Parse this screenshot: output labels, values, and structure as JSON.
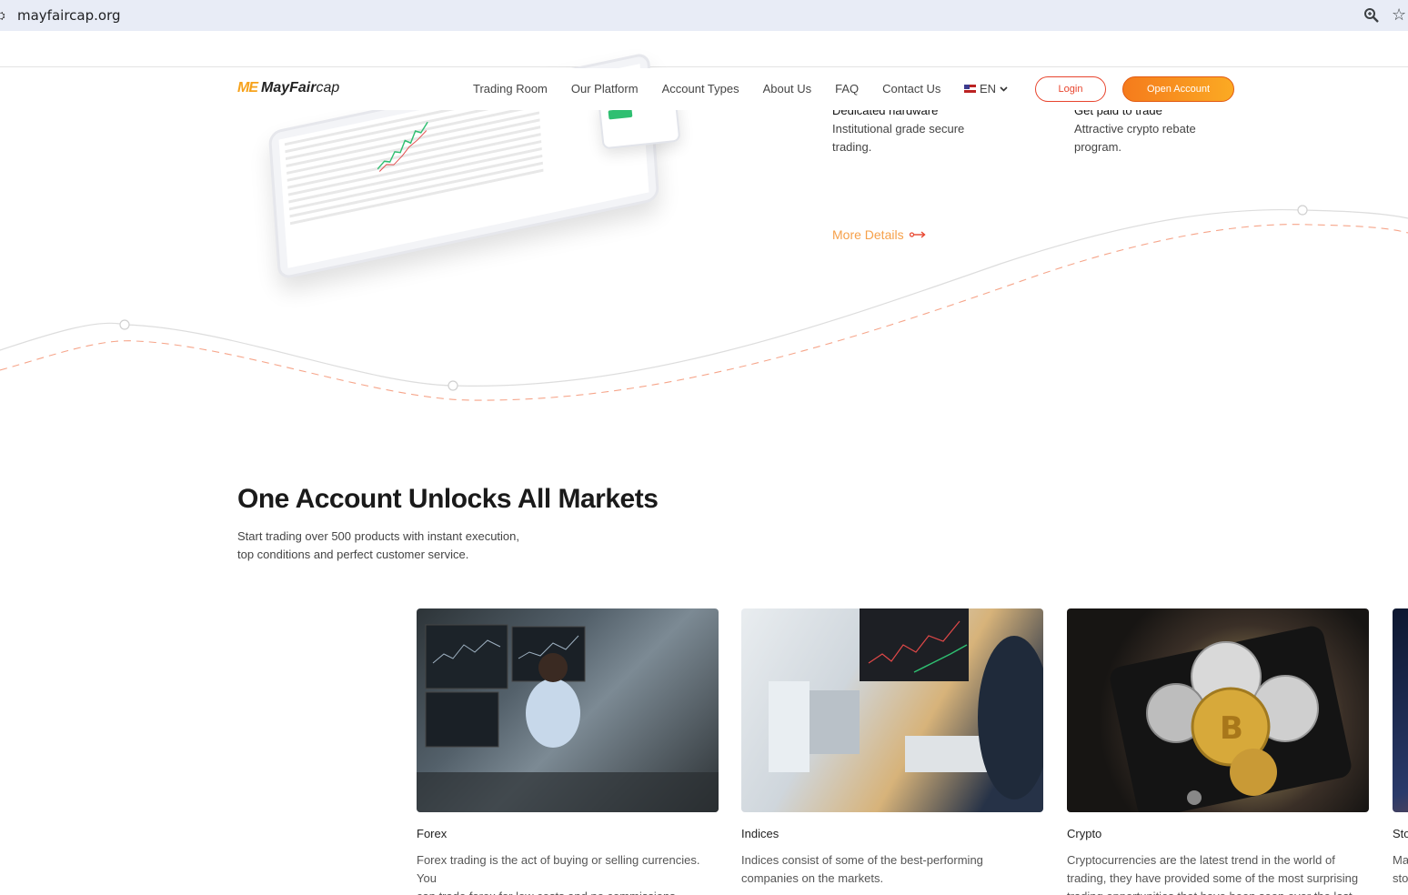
{
  "browser": {
    "url": "mayfaircap.org"
  },
  "header": {
    "logo_mark": "ME",
    "logo_brand_bold": "MayFair",
    "logo_brand_light": "cap",
    "nav": [
      "Trading Room",
      "Our Platform",
      "Account Types",
      "About Us",
      "FAQ",
      "Contact Us"
    ],
    "language": "EN",
    "login_label": "Login",
    "open_account_label": "Open Account"
  },
  "features": [
    {
      "title": "Dedicated hardware",
      "desc_line1": "Institutional grade secure",
      "desc_line2": "trading."
    },
    {
      "title": "Get paid to trade",
      "desc_line1": "Attractive crypto rebate",
      "desc_line2": "program."
    }
  ],
  "more_details_label": "More Details",
  "section": {
    "title": "One Account Unlocks All Markets",
    "subtitle_line1": "Start trading over 500 products with instant execution,",
    "subtitle_line2": "top conditions and perfect customer service."
  },
  "cards": [
    {
      "title": "Forex",
      "desc_line1": "Forex trading is the act of buying or selling currencies. You",
      "desc_line2": "can trade forex for low costs and no commissions.",
      "desc_line3": ""
    },
    {
      "title": "Indices",
      "desc_line1": "Indices consist of some of the best-performing",
      "desc_line2": "companies on the markets.",
      "desc_line3": ""
    },
    {
      "title": "Crypto",
      "desc_line1": "Cryptocurrencies are the latest trend in the world of",
      "desc_line2": "trading, they have provided some of the most surprising",
      "desc_line3": "trading opportunities that have been seen over the last"
    },
    {
      "title": "Sto",
      "desc_line1": "Ma",
      "desc_line2": "sto",
      "desc_line3": ""
    }
  ],
  "colors": {
    "accent_orange": "#f57b1c",
    "login_red": "#e8452e",
    "link_orange": "#f6a04a"
  }
}
